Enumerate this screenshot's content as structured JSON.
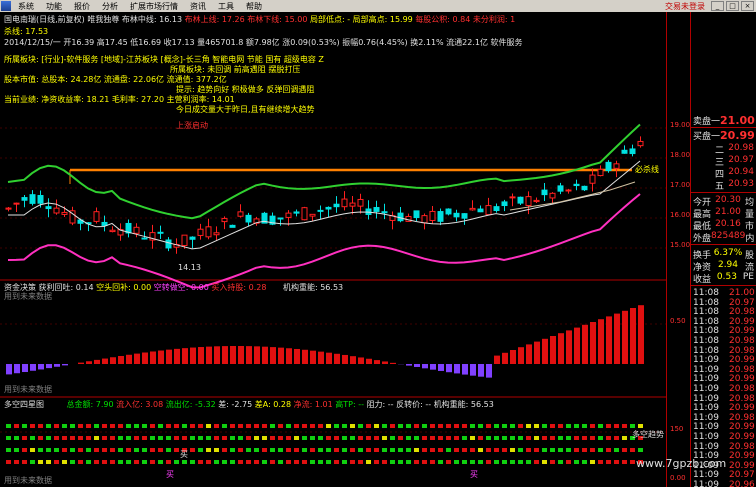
{
  "menubar": {
    "items": [
      "系统",
      "功能",
      "报价",
      "分析",
      "扩展市场行情",
      "资讯",
      "工具",
      "帮助"
    ],
    "window_title": "交易未登录"
  },
  "header": {
    "line1": {
      "a": "国电南瑞(日线,前复权)",
      "b": "唯我独尊",
      "c": "布林中线: 16.13",
      "d": "布林上线: 17.26",
      "e": "布林下线: 15.00",
      "f": "局部低点: -",
      "g": "局部高点: 15.99",
      "h": "每股公积: 0.84",
      "i": "未分利润: 1"
    },
    "line2": "杀线: 17.53",
    "line3": "2014/12/15/一 开16.39 高17.45 低16.69 收17.13 量465701.8 额7.98亿 涨0.09(0.53%) 振幅0.76(4.45%) 换2.11% 流通22.1亿 软件服务",
    "line4a": "所属板块: [行业]-软件服务 [地域]-江苏板块 [概念]-长三角 智能电网 节能 国有 超级电容 Z",
    "line4b": "所属板块: 未回调 前高遇阻 摆脱打压",
    "line5a": "股本市值: 总股本: 24.28亿 流通盘: 22.06亿 流通值: 377.2亿",
    "line5b": "提示: 趋势向好 积极做多 反弹回调遇阻",
    "line6": "当前业绩: 净资收益率: 18.21 毛利率: 27.20 主营利润率: 14.01",
    "line7": "今日成交量大于昨日,且有继续增大趋势",
    "line8": "上涨启动",
    "label_right": "必杀线",
    "bottom_low": "14.13",
    "watermark_main": "用到未来数据"
  },
  "main_axis": [
    "19.00",
    "18.00",
    "17.00",
    "16.00",
    "15.00"
  ],
  "panel2": {
    "title": "资金决策",
    "a": "获利回吐: 0.14",
    "b": "空头回补: 0.00",
    "c": "空转做空: 0.00",
    "d": "买入持股: 0.28",
    "e": "机构重能: 56.53",
    "axis": "0.50",
    "watermark": "用到未来数据"
  },
  "panel3": {
    "title": "多空四星图",
    "a": "总金额: 7.90",
    "b": "流入亿: 3.08",
    "c": "流出亿: -5.32",
    "d": "差: -2.75",
    "e": "差A: 0.28",
    "f": "净流: 1.01",
    "g": "高TP: --",
    "h": "阻力: --",
    "i": "反转价: --",
    "j": "机构重能: 56.53",
    "k": "多空趋势",
    "buy1": "买",
    "buy2": "买",
    "buy3": "买",
    "axis_top": "150",
    "axis_bottom": "0.00",
    "watermark": "用到未来数据"
  },
  "quote": {
    "sell_label": "卖盘",
    "sell_num": "一",
    "sell_price": "21.00",
    "buy_label": "买盘",
    "buy_num": "一",
    "buy_price": "20.99",
    "rows": [
      {
        "label": "二",
        "val": "20.98"
      },
      {
        "label": "三",
        "val": "20.97"
      },
      {
        "label": "四",
        "val": "20.94"
      },
      {
        "label": "五",
        "val": "20.93"
      },
      {
        "label": "今开",
        "val": "20.30",
        "ext": "均"
      },
      {
        "label": "最高",
        "val": "21.00",
        "ext": "量"
      },
      {
        "label": "最低",
        "val": "20.16",
        "ext": "市"
      },
      {
        "label": "外盘",
        "val": "825489",
        "ext": "内"
      },
      {
        "label": "换手",
        "val": "6.37%",
        "ext": "股"
      },
      {
        "label": "净资",
        "val": "2.94",
        "ext": "流"
      },
      {
        "label": "收益",
        "val": "0.53",
        "ext": "PE"
      }
    ]
  },
  "ticks": [
    {
      "t": "11:08",
      "v": "21.00"
    },
    {
      "t": "11:08",
      "v": "20.97"
    },
    {
      "t": "11:08",
      "v": "20.98"
    },
    {
      "t": "11:08",
      "v": "20.99"
    },
    {
      "t": "11:08",
      "v": "20.99"
    },
    {
      "t": "11:08",
      "v": "20.98"
    },
    {
      "t": "11:08",
      "v": "20.98"
    },
    {
      "t": "11:09",
      "v": "20.99"
    },
    {
      "t": "11:09",
      "v": "20.98"
    },
    {
      "t": "11:09",
      "v": "20.99"
    },
    {
      "t": "11:09",
      "v": "20.98"
    },
    {
      "t": "11:09",
      "v": "20.98"
    },
    {
      "t": "11:09",
      "v": "20.99"
    },
    {
      "t": "11:09",
      "v": "20.98"
    },
    {
      "t": "11:09",
      "v": "20.99"
    },
    {
      "t": "11:09",
      "v": "20.99"
    },
    {
      "t": "11:09",
      "v": "20.98"
    },
    {
      "t": "11:09",
      "v": "20.99"
    },
    {
      "t": "11:09",
      "v": "20.99"
    },
    {
      "t": "11:09",
      "v": "20.97"
    },
    {
      "t": "11:09",
      "v": "20.96"
    }
  ],
  "site_watermark": "www.7gpzb.com",
  "colors": {
    "up": "#ff2020",
    "down": "#00e0e0",
    "bg": "#000000",
    "frame": "#b00000"
  }
}
